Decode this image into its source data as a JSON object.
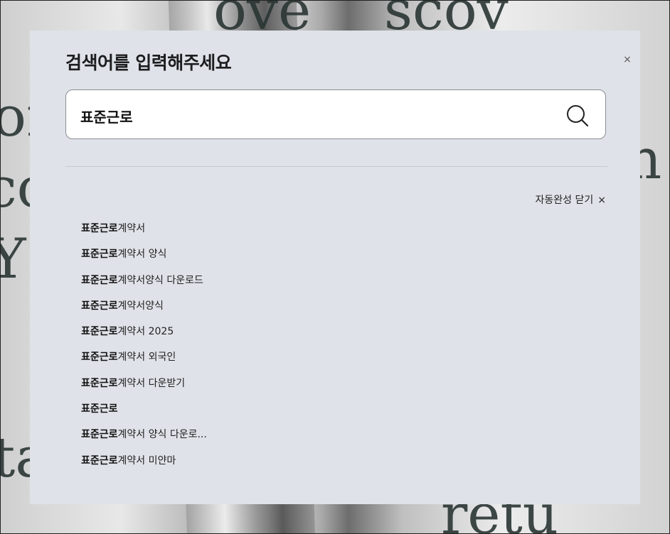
{
  "modal": {
    "title": "검색어를 입력해주세요",
    "close_label": "×"
  },
  "search": {
    "value": "표준근로",
    "placeholder": ""
  },
  "autocomplete": {
    "close_label": "자동완성 닫기",
    "close_icon": "×",
    "items": [
      {
        "match": "표준근로",
        "rest": "계약서"
      },
      {
        "match": "표준근로",
        "rest": "계약서 양식"
      },
      {
        "match": "표준근로",
        "rest": "계약서양식 다운로드"
      },
      {
        "match": "표준근로",
        "rest": "계약서양식"
      },
      {
        "match": "표준근로",
        "rest": "계약서 2025"
      },
      {
        "match": "표준근로",
        "rest": "계약서 외국인"
      },
      {
        "match": "표준근로",
        "rest": "계약서 다운받기"
      },
      {
        "match": "표준근로",
        "rest": ""
      },
      {
        "match": "표준근로",
        "rest": "계약서 양식 다운로..."
      },
      {
        "match": "표준근로",
        "rest": "계약서 미얀마"
      }
    ]
  },
  "colors": {
    "modal_bg": "#dfe2e8",
    "input_border": "#8b8e94",
    "text": "#222222"
  }
}
